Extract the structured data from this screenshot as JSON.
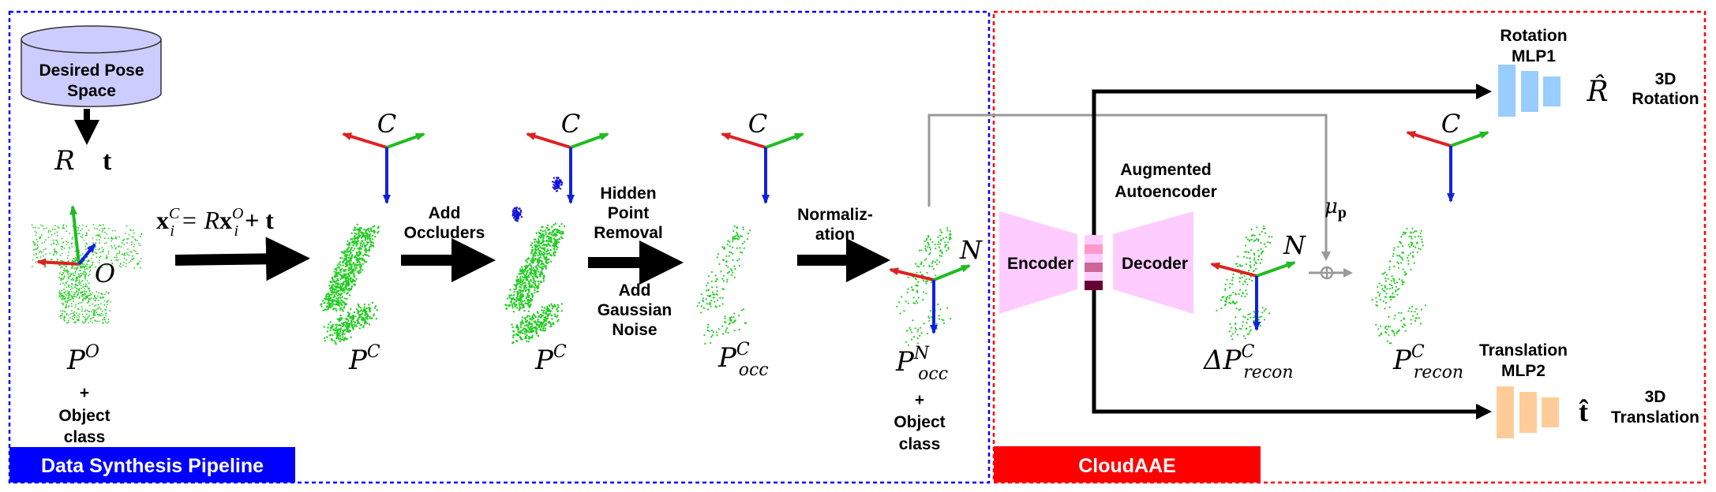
{
  "pipeline": {
    "title": "Data Synthesis Pipeline",
    "accent": "#0000ff",
    "database": {
      "line1": "Desired Pose",
      "line2": "Space"
    },
    "pose_R": "R",
    "pose_t": "t",
    "object_frame": "O",
    "camera_frame": "C",
    "normalized_frame": "N",
    "formula": {
      "x": "x",
      "sub_i": "i",
      "sup_C": "C",
      "eq": " = R",
      "x2": "x",
      "sup_O": "O",
      "plus_t": " + t"
    },
    "steps": [
      {
        "line1": "Add",
        "line2": "Occluders"
      },
      {
        "line1": "Hidden",
        "line2": "Point",
        "line3": "Removal"
      },
      {
        "line1": "Add",
        "line2": "Gaussian",
        "line3": "Noise"
      },
      {
        "line1": "Normaliz-",
        "line2": "ation"
      }
    ],
    "clouds": [
      {
        "base": "P",
        "sup": "O",
        "sub": ""
      },
      {
        "base": "P",
        "sup": "C",
        "sub": ""
      },
      {
        "base": "P",
        "sup": "C",
        "sub": ""
      },
      {
        "base": "P",
        "sup": "C",
        "sub": "occ"
      },
      {
        "base": "P",
        "sup": "N",
        "sub": "occ"
      }
    ],
    "object_class": {
      "plus": "+",
      "line1": "Object",
      "line2": "class"
    }
  },
  "cloudaae": {
    "title": "CloudAAE",
    "accent": "#ff0000",
    "autoencoder": {
      "line1": "Augmented",
      "line2": "Autoencoder"
    },
    "encoder": "Encoder",
    "decoder": "Decoder",
    "mu": "μ",
    "mu_sub": "p",
    "recon_delta": {
      "base": "ΔP",
      "sup": "C",
      "sub": "recon"
    },
    "recon": {
      "base": "P",
      "sup": "C",
      "sub": "recon"
    },
    "rotation_mlp": {
      "line1": "Rotation",
      "line2": "MLP1",
      "color": "#99ccff"
    },
    "translation_mlp": {
      "line1": "Translation",
      "line2": "MLP2",
      "color": "#ffcc99"
    },
    "R_hat": "R̂",
    "t_hat": "t̂",
    "rotation_out": {
      "line1": "3D",
      "line2": "Rotation"
    },
    "translation_out": {
      "line1": "3D",
      "line2": "Translation"
    }
  },
  "colors": {
    "cloud": "#22cc22",
    "occluder": "#1111dd",
    "axis_x": "#dd2222",
    "axis_y": "#22bb22",
    "axis_z": "#1122dd",
    "latent": [
      "#ff99cc",
      "#cc6699",
      "#660033"
    ],
    "trapezoid": "#ffccff"
  }
}
